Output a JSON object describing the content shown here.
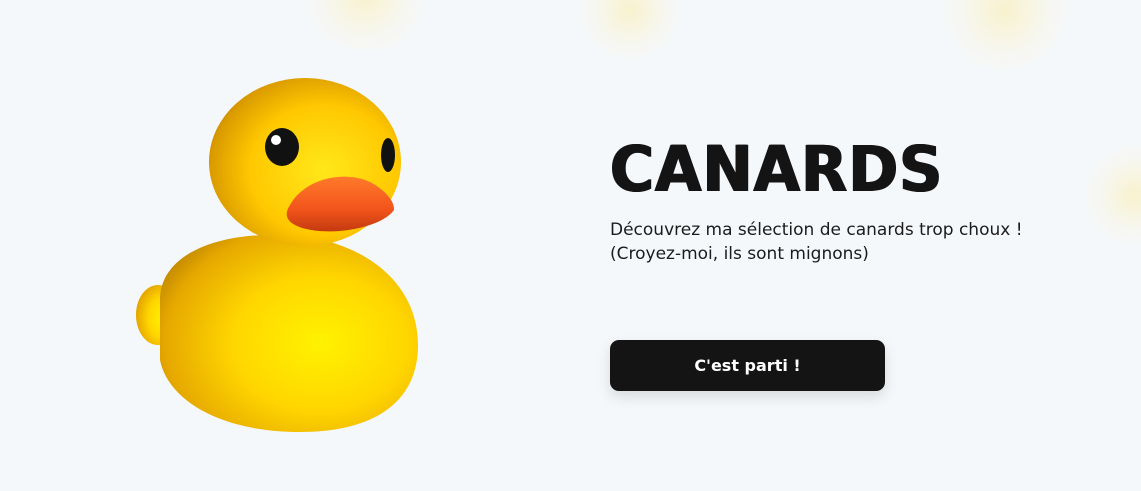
{
  "hero": {
    "title": "CANARDS",
    "subtitle": "Découvrez ma sélection de canards trop choux !\n(Croyez-moi, ils sont mignons)",
    "cta_label": "C'est parti !"
  },
  "duck": {
    "icon": "rubber-duck",
    "body_color": "#FFD400",
    "beak_color": "#F2541B",
    "eye_color": "#111111"
  },
  "colors": {
    "background": "#F5F8FB",
    "text": "#141414",
    "button_bg": "#141414",
    "button_text": "#FFFFFF"
  }
}
